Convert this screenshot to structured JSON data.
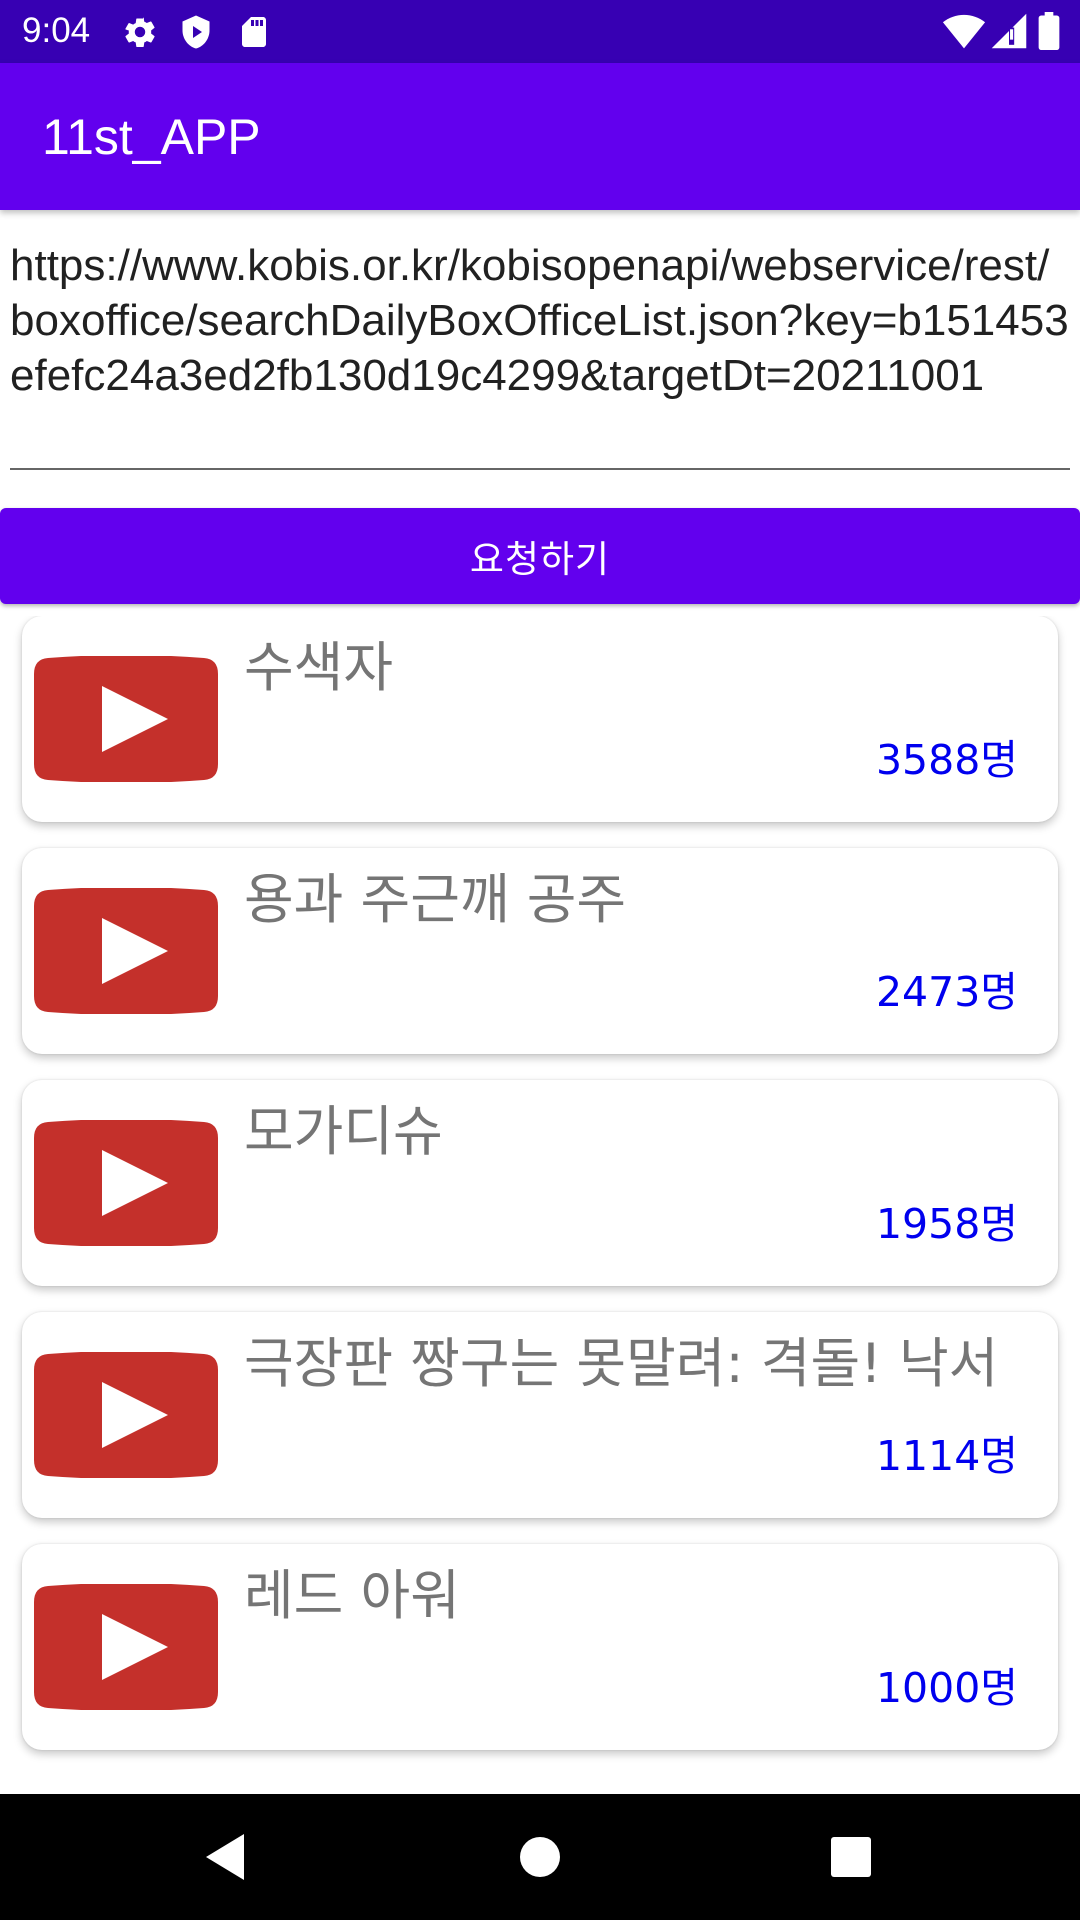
{
  "status_bar": {
    "time": "9:04",
    "left_icons": [
      "gear-icon",
      "shield-icon",
      "sd-card-icon"
    ],
    "right_icons": [
      "wifi-icon",
      "cell-signal-icon",
      "battery-icon"
    ]
  },
  "app_bar": {
    "title": "11st_APP"
  },
  "url_field": {
    "value": "https://www.kobis.or.kr/kobisopenapi/webservice/rest/boxoffice/searchDailyBoxOfficeList.json?key=b151453efefc24a3ed2fb130d19c4299&targetDt=20211001"
  },
  "request_button": {
    "label": "요청하기"
  },
  "movies": [
    {
      "title": "수색자",
      "count": "3588명",
      "icon": "play-icon"
    },
    {
      "title": "용과 주근깨 공주",
      "count": "2473명",
      "icon": "play-icon"
    },
    {
      "title": "모가디슈",
      "count": "1958명",
      "icon": "play-icon"
    },
    {
      "title": "극장판 짱구는 못말려: 격돌! 낙서",
      "count": "1114명",
      "icon": "play-icon"
    },
    {
      "title": "레드 아워",
      "count": "1000명",
      "icon": "play-icon"
    }
  ],
  "nav_bar": {
    "buttons": [
      "back-icon",
      "home-icon",
      "recents-icon"
    ]
  },
  "colors": {
    "status_bar": "#3700B3",
    "primary": "#6200EE",
    "count_text": "#0000EE",
    "title_text": "#757575",
    "play_red": "#C4302B"
  }
}
